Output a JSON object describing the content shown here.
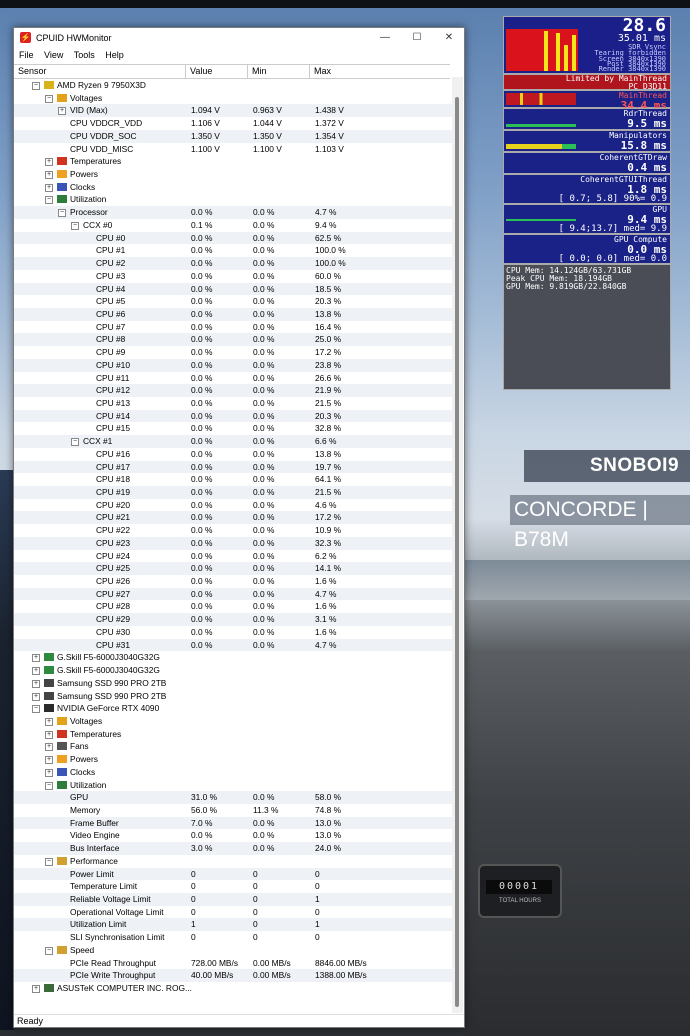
{
  "app": {
    "title": "CPUID HWMonitor",
    "menu": [
      "File",
      "View",
      "Tools",
      "Help"
    ],
    "columns": [
      "Sensor",
      "Value",
      "Min",
      "Max"
    ],
    "status": "Ready"
  },
  "tree": [
    {
      "indent": 0,
      "exp": "-",
      "icon": "cpu",
      "label": "AMD Ryzen 9 7950X3D",
      "v": "",
      "mn": "",
      "mx": ""
    },
    {
      "indent": 1,
      "exp": "-",
      "icon": "volt",
      "label": "Voltages",
      "v": "",
      "mn": "",
      "mx": ""
    },
    {
      "indent": 2,
      "exp": "+",
      "icon": "",
      "label": "VID (Max)",
      "v": "1.094 V",
      "mn": "0.963 V",
      "mx": "1.438 V"
    },
    {
      "indent": 2,
      "exp": "",
      "icon": "",
      "label": "CPU VDDCR_VDD",
      "v": "1.106 V",
      "mn": "1.044 V",
      "mx": "1.372 V"
    },
    {
      "indent": 2,
      "exp": "",
      "icon": "",
      "label": "CPU VDDR_SOC",
      "v": "1.350 V",
      "mn": "1.350 V",
      "mx": "1.354 V"
    },
    {
      "indent": 2,
      "exp": "",
      "icon": "",
      "label": "CPU VDD_MISC",
      "v": "1.100 V",
      "mn": "1.100 V",
      "mx": "1.103 V"
    },
    {
      "indent": 1,
      "exp": "+",
      "icon": "temp",
      "label": "Temperatures",
      "v": "",
      "mn": "",
      "mx": ""
    },
    {
      "indent": 1,
      "exp": "+",
      "icon": "power",
      "label": "Powers",
      "v": "",
      "mn": "",
      "mx": ""
    },
    {
      "indent": 1,
      "exp": "+",
      "icon": "clock",
      "label": "Clocks",
      "v": "",
      "mn": "",
      "mx": ""
    },
    {
      "indent": 1,
      "exp": "-",
      "icon": "util",
      "label": "Utilization",
      "v": "",
      "mn": "",
      "mx": ""
    },
    {
      "indent": 2,
      "exp": "-",
      "icon": "",
      "label": "Processor",
      "v": "0.0 %",
      "mn": "0.0 %",
      "mx": "4.7 %"
    },
    {
      "indent": 3,
      "exp": "-",
      "icon": "",
      "label": "CCX #0",
      "v": "0.1 %",
      "mn": "0.0 %",
      "mx": "9.4 %"
    },
    {
      "indent": 4,
      "exp": "",
      "icon": "",
      "label": "CPU #0",
      "v": "0.0 %",
      "mn": "0.0 %",
      "mx": "62.5 %"
    },
    {
      "indent": 4,
      "exp": "",
      "icon": "",
      "label": "CPU #1",
      "v": "0.0 %",
      "mn": "0.0 %",
      "mx": "100.0 %"
    },
    {
      "indent": 4,
      "exp": "",
      "icon": "",
      "label": "CPU #2",
      "v": "0.0 %",
      "mn": "0.0 %",
      "mx": "100.0 %"
    },
    {
      "indent": 4,
      "exp": "",
      "icon": "",
      "label": "CPU #3",
      "v": "0.0 %",
      "mn": "0.0 %",
      "mx": "60.0 %"
    },
    {
      "indent": 4,
      "exp": "",
      "icon": "",
      "label": "CPU #4",
      "v": "0.0 %",
      "mn": "0.0 %",
      "mx": "18.5 %"
    },
    {
      "indent": 4,
      "exp": "",
      "icon": "",
      "label": "CPU #5",
      "v": "0.0 %",
      "mn": "0.0 %",
      "mx": "20.3 %"
    },
    {
      "indent": 4,
      "exp": "",
      "icon": "",
      "label": "CPU #6",
      "v": "0.0 %",
      "mn": "0.0 %",
      "mx": "13.8 %"
    },
    {
      "indent": 4,
      "exp": "",
      "icon": "",
      "label": "CPU #7",
      "v": "0.0 %",
      "mn": "0.0 %",
      "mx": "16.4 %"
    },
    {
      "indent": 4,
      "exp": "",
      "icon": "",
      "label": "CPU #8",
      "v": "0.0 %",
      "mn": "0.0 %",
      "mx": "25.0 %"
    },
    {
      "indent": 4,
      "exp": "",
      "icon": "",
      "label": "CPU #9",
      "v": "0.0 %",
      "mn": "0.0 %",
      "mx": "17.2 %"
    },
    {
      "indent": 4,
      "exp": "",
      "icon": "",
      "label": "CPU #10",
      "v": "0.0 %",
      "mn": "0.0 %",
      "mx": "23.8 %"
    },
    {
      "indent": 4,
      "exp": "",
      "icon": "",
      "label": "CPU #11",
      "v": "0.0 %",
      "mn": "0.0 %",
      "mx": "26.6 %"
    },
    {
      "indent": 4,
      "exp": "",
      "icon": "",
      "label": "CPU #12",
      "v": "0.0 %",
      "mn": "0.0 %",
      "mx": "21.9 %"
    },
    {
      "indent": 4,
      "exp": "",
      "icon": "",
      "label": "CPU #13",
      "v": "0.0 %",
      "mn": "0.0 %",
      "mx": "21.5 %"
    },
    {
      "indent": 4,
      "exp": "",
      "icon": "",
      "label": "CPU #14",
      "v": "0.0 %",
      "mn": "0.0 %",
      "mx": "20.3 %"
    },
    {
      "indent": 4,
      "exp": "",
      "icon": "",
      "label": "CPU #15",
      "v": "0.0 %",
      "mn": "0.0 %",
      "mx": "32.8 %"
    },
    {
      "indent": 3,
      "exp": "-",
      "icon": "",
      "label": "CCX #1",
      "v": "0.0 %",
      "mn": "0.0 %",
      "mx": "6.6 %"
    },
    {
      "indent": 4,
      "exp": "",
      "icon": "",
      "label": "CPU #16",
      "v": "0.0 %",
      "mn": "0.0 %",
      "mx": "13.8 %"
    },
    {
      "indent": 4,
      "exp": "",
      "icon": "",
      "label": "CPU #17",
      "v": "0.0 %",
      "mn": "0.0 %",
      "mx": "19.7 %"
    },
    {
      "indent": 4,
      "exp": "",
      "icon": "",
      "label": "CPU #18",
      "v": "0.0 %",
      "mn": "0.0 %",
      "mx": "64.1 %"
    },
    {
      "indent": 4,
      "exp": "",
      "icon": "",
      "label": "CPU #19",
      "v": "0.0 %",
      "mn": "0.0 %",
      "mx": "21.5 %"
    },
    {
      "indent": 4,
      "exp": "",
      "icon": "",
      "label": "CPU #20",
      "v": "0.0 %",
      "mn": "0.0 %",
      "mx": "4.6 %"
    },
    {
      "indent": 4,
      "exp": "",
      "icon": "",
      "label": "CPU #21",
      "v": "0.0 %",
      "mn": "0.0 %",
      "mx": "17.2 %"
    },
    {
      "indent": 4,
      "exp": "",
      "icon": "",
      "label": "CPU #22",
      "v": "0.0 %",
      "mn": "0.0 %",
      "mx": "10.9 %"
    },
    {
      "indent": 4,
      "exp": "",
      "icon": "",
      "label": "CPU #23",
      "v": "0.0 %",
      "mn": "0.0 %",
      "mx": "32.3 %"
    },
    {
      "indent": 4,
      "exp": "",
      "icon": "",
      "label": "CPU #24",
      "v": "0.0 %",
      "mn": "0.0 %",
      "mx": "6.2 %"
    },
    {
      "indent": 4,
      "exp": "",
      "icon": "",
      "label": "CPU #25",
      "v": "0.0 %",
      "mn": "0.0 %",
      "mx": "14.1 %"
    },
    {
      "indent": 4,
      "exp": "",
      "icon": "",
      "label": "CPU #26",
      "v": "0.0 %",
      "mn": "0.0 %",
      "mx": "1.6 %"
    },
    {
      "indent": 4,
      "exp": "",
      "icon": "",
      "label": "CPU #27",
      "v": "0.0 %",
      "mn": "0.0 %",
      "mx": "4.7 %"
    },
    {
      "indent": 4,
      "exp": "",
      "icon": "",
      "label": "CPU #28",
      "v": "0.0 %",
      "mn": "0.0 %",
      "mx": "1.6 %"
    },
    {
      "indent": 4,
      "exp": "",
      "icon": "",
      "label": "CPU #29",
      "v": "0.0 %",
      "mn": "0.0 %",
      "mx": "3.1 %"
    },
    {
      "indent": 4,
      "exp": "",
      "icon": "",
      "label": "CPU #30",
      "v": "0.0 %",
      "mn": "0.0 %",
      "mx": "1.6 %"
    },
    {
      "indent": 4,
      "exp": "",
      "icon": "",
      "label": "CPU #31",
      "v": "0.0 %",
      "mn": "0.0 %",
      "mx": "4.7 %"
    },
    {
      "indent": 0,
      "exp": "+",
      "icon": "ram",
      "label": "G.Skill F5-6000J3040G32G",
      "v": "",
      "mn": "",
      "mx": ""
    },
    {
      "indent": 0,
      "exp": "+",
      "icon": "ram",
      "label": "G.Skill F5-6000J3040G32G",
      "v": "",
      "mn": "",
      "mx": ""
    },
    {
      "indent": 0,
      "exp": "+",
      "icon": "ssd",
      "label": "Samsung SSD 990 PRO 2TB",
      "v": "",
      "mn": "",
      "mx": ""
    },
    {
      "indent": 0,
      "exp": "+",
      "icon": "ssd",
      "label": "Samsung SSD 990 PRO 2TB",
      "v": "",
      "mn": "",
      "mx": ""
    },
    {
      "indent": 0,
      "exp": "-",
      "icon": "gpu",
      "label": "NVIDIA GeForce RTX 4090",
      "v": "",
      "mn": "",
      "mx": ""
    },
    {
      "indent": 1,
      "exp": "+",
      "icon": "volt",
      "label": "Voltages",
      "v": "",
      "mn": "",
      "mx": ""
    },
    {
      "indent": 1,
      "exp": "+",
      "icon": "temp",
      "label": "Temperatures",
      "v": "",
      "mn": "",
      "mx": ""
    },
    {
      "indent": 1,
      "exp": "+",
      "icon": "fan",
      "label": "Fans",
      "v": "",
      "mn": "",
      "mx": ""
    },
    {
      "indent": 1,
      "exp": "+",
      "icon": "power",
      "label": "Powers",
      "v": "",
      "mn": "",
      "mx": ""
    },
    {
      "indent": 1,
      "exp": "+",
      "icon": "clock",
      "label": "Clocks",
      "v": "",
      "mn": "",
      "mx": ""
    },
    {
      "indent": 1,
      "exp": "-",
      "icon": "util",
      "label": "Utilization",
      "v": "",
      "mn": "",
      "mx": ""
    },
    {
      "indent": 2,
      "exp": "",
      "icon": "",
      "label": "GPU",
      "v": "31.0 %",
      "mn": "0.0 %",
      "mx": "58.0 %"
    },
    {
      "indent": 2,
      "exp": "",
      "icon": "",
      "label": "Memory",
      "v": "56.0 %",
      "mn": "11.3 %",
      "mx": "74.8 %"
    },
    {
      "indent": 2,
      "exp": "",
      "icon": "",
      "label": "Frame Buffer",
      "v": "7.0 %",
      "mn": "0.0 %",
      "mx": "13.0 %"
    },
    {
      "indent": 2,
      "exp": "",
      "icon": "",
      "label": "Video Engine",
      "v": "0.0 %",
      "mn": "0.0 %",
      "mx": "13.0 %"
    },
    {
      "indent": 2,
      "exp": "",
      "icon": "",
      "label": "Bus Interface",
      "v": "3.0 %",
      "mn": "0.0 %",
      "mx": "24.0 %"
    },
    {
      "indent": 1,
      "exp": "-",
      "icon": "perf",
      "label": "Performance",
      "v": "",
      "mn": "",
      "mx": ""
    },
    {
      "indent": 2,
      "exp": "",
      "icon": "",
      "label": "Power Limit",
      "v": "0",
      "mn": "0",
      "mx": "0"
    },
    {
      "indent": 2,
      "exp": "",
      "icon": "",
      "label": "Temperature Limit",
      "v": "0",
      "mn": "0",
      "mx": "0"
    },
    {
      "indent": 2,
      "exp": "",
      "icon": "",
      "label": "Reliable Voltage Limit",
      "v": "0",
      "mn": "0",
      "mx": "1"
    },
    {
      "indent": 2,
      "exp": "",
      "icon": "",
      "label": "Operational Voltage Limit",
      "v": "0",
      "mn": "0",
      "mx": "0"
    },
    {
      "indent": 2,
      "exp": "",
      "icon": "",
      "label": "Utilization Limit",
      "v": "1",
      "mn": "0",
      "mx": "1"
    },
    {
      "indent": 2,
      "exp": "",
      "icon": "",
      "label": "SLI Synchronisation Limit",
      "v": "0",
      "mn": "0",
      "mx": "0"
    },
    {
      "indent": 1,
      "exp": "-",
      "icon": "perf",
      "label": "Speed",
      "v": "",
      "mn": "",
      "mx": ""
    },
    {
      "indent": 2,
      "exp": "",
      "icon": "",
      "label": "PCIe Read Throughput",
      "v": "728.00 MB/s",
      "mn": "0.00 MB/s",
      "mx": "8846.00 MB/s"
    },
    {
      "indent": 2,
      "exp": "",
      "icon": "",
      "label": "PCIe Write Throughput",
      "v": "40.00 MB/s",
      "mn": "0.00 MB/s",
      "mx": "1388.00 MB/s"
    },
    {
      "indent": 0,
      "exp": "+",
      "icon": "board",
      "label": "ASUSTeK COMPUTER INC. ROG...",
      "v": "",
      "mn": "",
      "mx": ""
    }
  ],
  "overlay": {
    "fps": "28.6",
    "fps_ms": "35.01 ms",
    "fps_lines": [
      "SDR Vsync",
      "Tearing forbidden",
      "Screen 3840x1390",
      "Post 3840x1390",
      "Render 3840x1390"
    ],
    "limited": "Limited by MainThread",
    "api": "PC D3D11",
    "main_thread": {
      "title": "MainThread",
      "value": "34.4 ms"
    },
    "rdr_thread": {
      "title": "RdrThread",
      "value": "9.5 ms"
    },
    "manipulators": {
      "title": "Manipulators",
      "value": "15.8 ms"
    },
    "coherent_draw": {
      "title": "CoherentGTDraw",
      "value": "0.4 ms"
    },
    "coherent_ui": {
      "title": "CoherentGTUIThread",
      "value": "1.8 ms",
      "stats": "[ 0.7; 5.8] 90%= 0.9"
    },
    "gpu": {
      "title": "GPU",
      "value": "9.4 ms",
      "stats": "[ 9.4;13.7] med= 9.9"
    },
    "gpu_compute": {
      "title": "GPU Compute",
      "value": "0.0 ms",
      "stats": "[ 0.0; 0.0] med= 0.0"
    },
    "mem": [
      "CPU Mem: 14.124GB/63.731GB",
      "Peak CPU Mem: 18.194GB",
      "GPU Mem: 9.819GB/22.840GB"
    ]
  },
  "scene": {
    "label_snob": "SNOBOI9",
    "label_conc": "CONCORDE | B78M",
    "gauge_digits": "00001",
    "gauge_label": "TOTAL HOURS"
  }
}
